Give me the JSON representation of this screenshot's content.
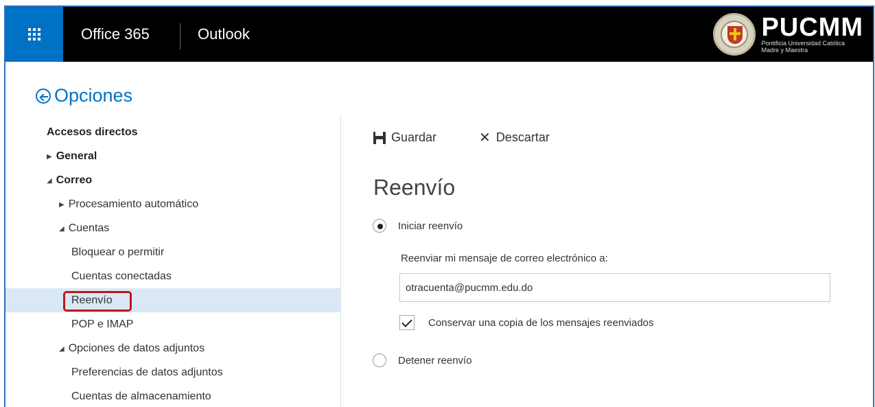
{
  "header": {
    "suite_name": "Office 365",
    "app_name": "Outlook",
    "brand": {
      "title": "PUCMM",
      "subtitle_line1": "Pontificia Universidad Católica",
      "subtitle_line2": "Madre y Maestra"
    }
  },
  "options": {
    "back_label": "Opciones"
  },
  "nav": {
    "items": [
      {
        "label": "Accesos directos",
        "level": 0,
        "bold": true,
        "expander": ""
      },
      {
        "label": "General",
        "level": 0,
        "bold": true,
        "expander": "collapsed"
      },
      {
        "label": "Correo",
        "level": 0,
        "bold": true,
        "expander": "expanded"
      },
      {
        "label": "Procesamiento automático",
        "level": 1,
        "bold": false,
        "expander": "collapsed"
      },
      {
        "label": "Cuentas",
        "level": 1,
        "bold": false,
        "expander": "expanded"
      },
      {
        "label": "Bloquear o permitir",
        "level": 2,
        "bold": false,
        "expander": ""
      },
      {
        "label": "Cuentas conectadas",
        "level": 2,
        "bold": false,
        "expander": ""
      },
      {
        "label": "Reenvío",
        "level": 2,
        "bold": false,
        "expander": "",
        "selected": true
      },
      {
        "label": "POP e IMAP",
        "level": 2,
        "bold": false,
        "expander": ""
      },
      {
        "label": "Opciones de datos adjuntos",
        "level": 1,
        "bold": false,
        "expander": "expanded"
      },
      {
        "label": "Preferencias de datos adjuntos",
        "level": 2,
        "bold": false,
        "expander": ""
      },
      {
        "label": "Cuentas de almacenamiento",
        "level": 2,
        "bold": false,
        "expander": ""
      }
    ]
  },
  "toolbar": {
    "save_label": "Guardar",
    "discard_label": "Descartar"
  },
  "main": {
    "title": "Reenvío",
    "start_forwarding_label": "Iniciar reenvío",
    "start_forwarding_checked": true,
    "forward_to_label": "Reenviar mi mensaje de correo electrónico a:",
    "forward_to_value": "otracuenta@pucmm.edu.do",
    "keep_copy_label": "Conservar una copia de los mensajes reenviados",
    "keep_copy_checked": true,
    "stop_forwarding_label": "Detener reenvío",
    "stop_forwarding_checked": false
  },
  "colors": {
    "accent": "#0072c6",
    "topbar": "#000000",
    "selected_row": "#dae8f6",
    "highlight_box": "#c0151a"
  }
}
